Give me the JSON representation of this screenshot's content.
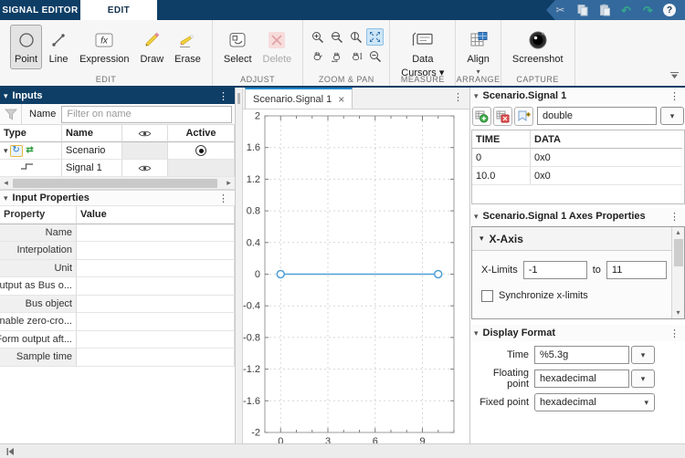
{
  "titlebar": {
    "tabs": [
      {
        "label": "SIGNAL EDITOR"
      },
      {
        "label": "EDIT"
      }
    ]
  },
  "icons": {
    "kebab": "⋮",
    "caret_down": "▾",
    "close": "×",
    "cut": "✂",
    "undo": "↶",
    "redo": "↷",
    "help": "?",
    "scroll_left": "◂",
    "scroll_right": "▸",
    "scroll_up": "▴",
    "scroll_down": "▾",
    "dropdown": "▾",
    "collapse_toolstrip": "▲"
  },
  "toolstrip": {
    "edit": {
      "label": "EDIT",
      "point": "Point",
      "line": "Line",
      "expression": "Expression",
      "draw": "Draw",
      "erase": "Erase"
    },
    "adjust": {
      "label": "ADJUST",
      "select": "Select",
      "delete": "Delete"
    },
    "zoom_pan": {
      "label": "ZOOM & PAN"
    },
    "measure": {
      "label": "MEASURE",
      "data_cursors_line1": "Data",
      "data_cursors_line2": "Cursors ▾"
    },
    "arrange": {
      "label": "ARRANGE",
      "align": "Align"
    },
    "capture": {
      "label": "CAPTURE",
      "screenshot": "Screenshot"
    }
  },
  "inputs_panel": {
    "title": "Inputs",
    "filter_label": "Name",
    "filter_placeholder": "Filter on name",
    "columns": {
      "type": "Type",
      "name": "Name",
      "active": "Active"
    },
    "rows": [
      {
        "name": "Scenario",
        "active": "selected"
      },
      {
        "name": "Signal 1",
        "visible": "visible"
      }
    ]
  },
  "input_properties": {
    "title": "Input Properties",
    "columns": {
      "property": "Property",
      "value": "Value"
    },
    "rows": [
      {
        "property": "Name",
        "value": ""
      },
      {
        "property": "Interpolation",
        "value": ""
      },
      {
        "property": "Unit",
        "value": ""
      },
      {
        "property": "Output as Bus o...",
        "value": ""
      },
      {
        "property": "Bus object",
        "value": ""
      },
      {
        "property": "Enable zero-cro...",
        "value": ""
      },
      {
        "property": "Form output aft...",
        "value": ""
      },
      {
        "property": "Sample time",
        "value": ""
      }
    ]
  },
  "document": {
    "tab_label": "Scenario.Signal 1"
  },
  "signal_panel": {
    "title": "Scenario.Signal 1",
    "type_value": "double",
    "columns": {
      "time": "TIME",
      "data": "DATA"
    },
    "rows": [
      {
        "time": "0",
        "data": "0x0"
      },
      {
        "time": "10.0",
        "data": "0x0"
      }
    ]
  },
  "axes_panel": {
    "title": "Scenario.Signal 1 Axes Properties",
    "x_axis_label": "X-Axis",
    "x_limits_label": "X-Limits",
    "x_min": "-1",
    "to_label": "to",
    "x_max": "11",
    "sync_label": "Synchronize x-limits",
    "sync_checked": false
  },
  "display_format": {
    "title": "Display Format",
    "time_label": "Time",
    "time_value": "%5.3g",
    "floating_label": "Floating point",
    "floating_value": "hexadecimal",
    "fixed_label": "Fixed point",
    "fixed_value": "hexadecimal"
  },
  "colors": {
    "accent_navy": "#0e3e66",
    "active_tab_blue": "#2287cc",
    "signal_blue": "#4D9FD6",
    "undo_teal": "#35a68c",
    "zoom_selected_bg": "#cde6f7"
  },
  "chart_data": {
    "type": "line",
    "title": "",
    "xlabel": "",
    "ylabel": "",
    "x_range": [
      -1,
      11
    ],
    "y_range": [
      -2,
      2
    ],
    "x_major_ticks": [
      0,
      3,
      6,
      9
    ],
    "x_minor_step": 1,
    "y_tick_step": 0.4,
    "grid": "dashed",
    "series": [
      {
        "name": "Scenario.Signal 1",
        "x": [
          0,
          10
        ],
        "y": [
          0,
          0
        ],
        "color": "#4D9FD6",
        "marker": "open-circle"
      }
    ]
  }
}
